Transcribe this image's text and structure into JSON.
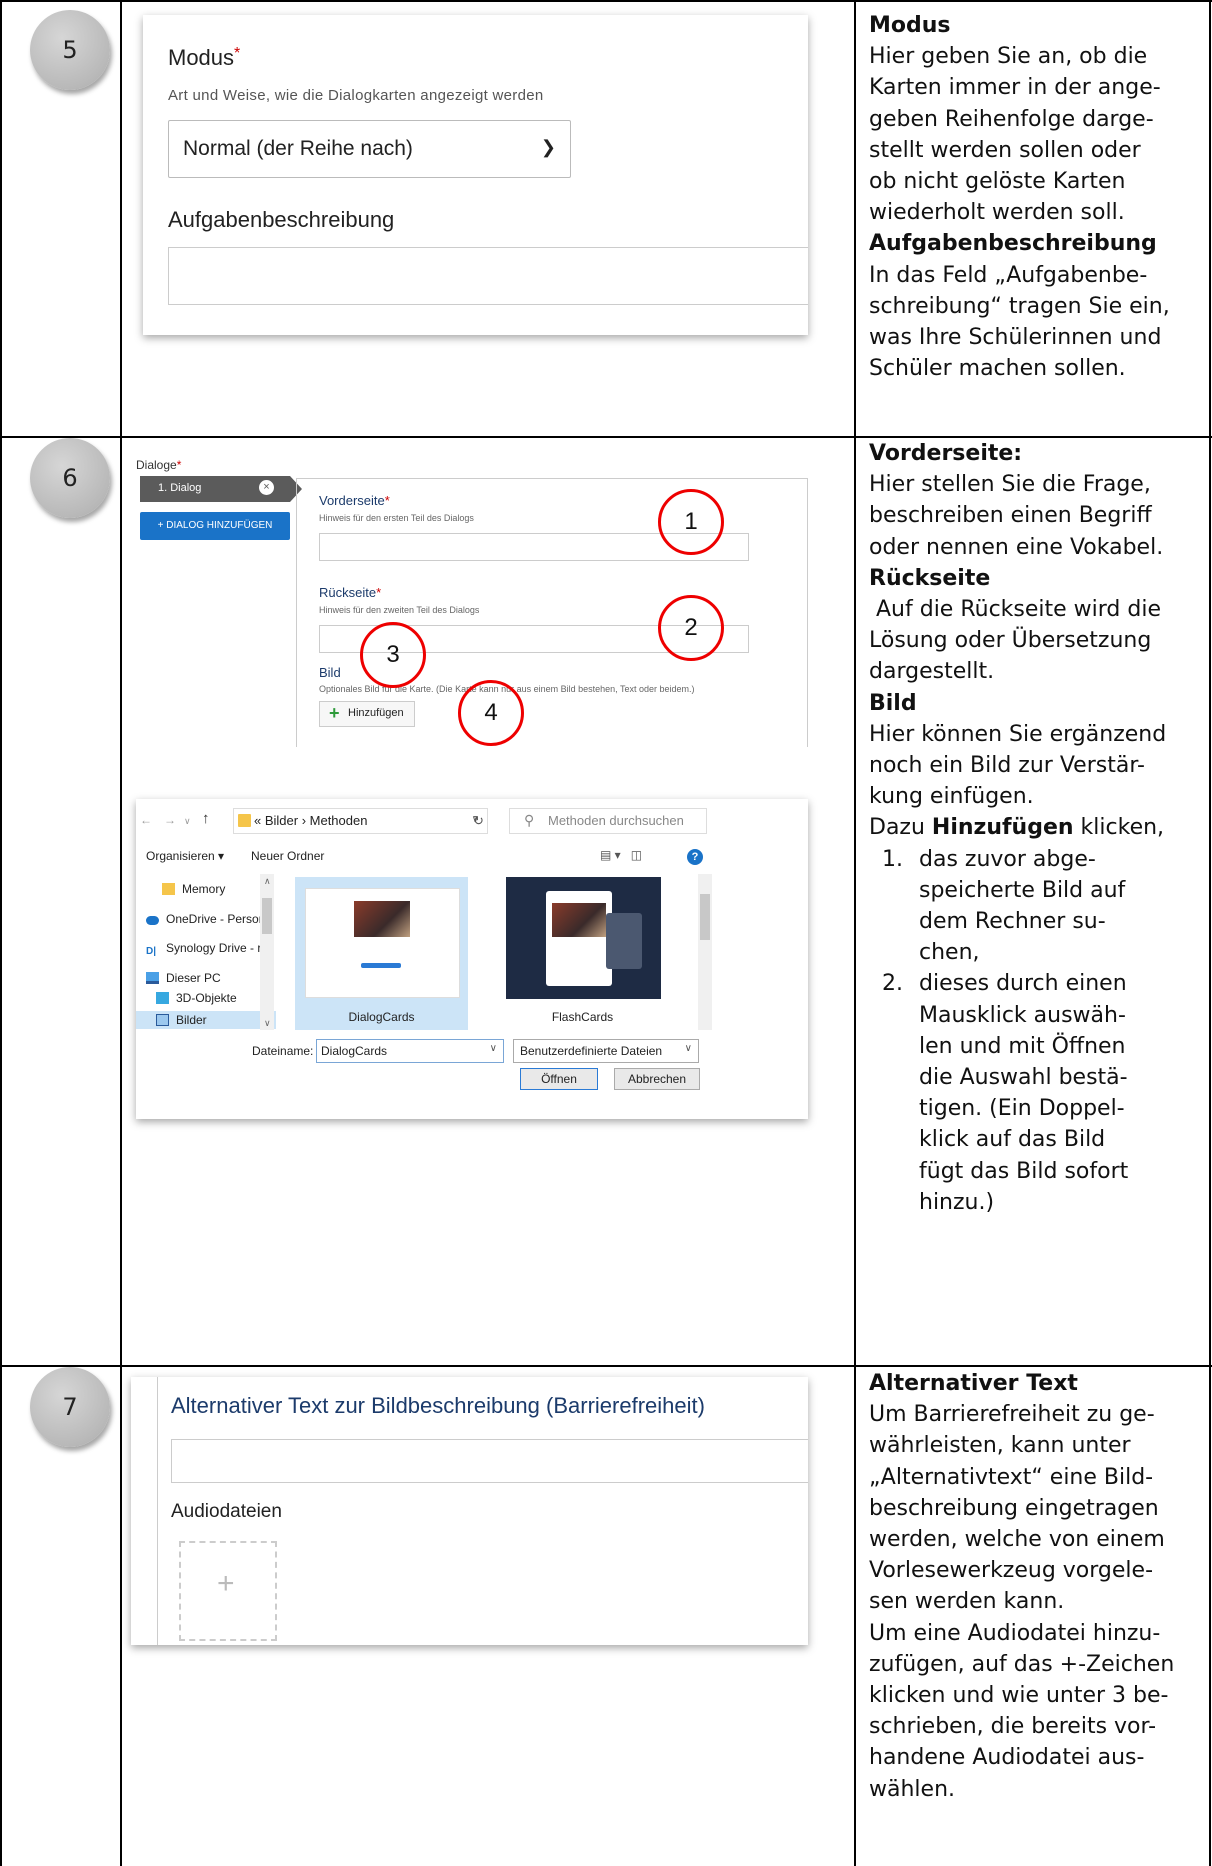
{
  "rows": [
    {
      "number": "5",
      "screenshot": {
        "mode_label": "Modus",
        "required_mark": "*",
        "mode_hint": "Art und Weise, wie die Dialogkarten angezeigt werden",
        "mode_selected": "Normal (der Reihe nach)",
        "task_label": "Aufgabenbeschreibung",
        "task_value": ""
      },
      "description": {
        "h1": "Modus",
        "lines1": [
          "Hier geben Sie an, ob die",
          "Karten immer in der ange-",
          "geben Reihenfolge darge-",
          "stellt werden sollen oder",
          "ob nicht gelöste Karten",
          "wiederholt werden soll."
        ],
        "h2": "Aufgabenbeschreibung",
        "lines2": [
          "In das Feld „Aufgabenbe-",
          "schreibung“ tragen Sie ein,",
          "was Ihre Schülerinnen und",
          "Schüler machen sollen."
        ]
      }
    },
    {
      "number": "6",
      "screenshot_editor": {
        "dialogs_label": "Dialoge",
        "required_mark": "*",
        "tab_label": "1. Dialog",
        "add_dialog_button": "+ DIALOG HINZUFÜGEN",
        "front_label": "Vorderseite",
        "front_hint": "Hinweis für den ersten Teil des Dialogs",
        "back_label": "Rückseite",
        "back_hint": "Hinweis für den zweiten Teil des Dialogs",
        "image_label": "Bild",
        "image_hint": "Optionales Bild für die Karte. (Die Karte kann nur aus einem Bild bestehen, Text oder beidem.)",
        "add_button": "Hinzufügen",
        "callouts": [
          "1",
          "2",
          "3",
          "4"
        ]
      },
      "screenshot_file_dialog": {
        "nav_back": "←",
        "nav_forward": "→",
        "nav_down": "∨",
        "nav_up": "↑",
        "path": "« Bilder › Methoden",
        "search_placeholder": "Methoden durchsuchen",
        "organize": "Organisieren ▾",
        "new_folder": "Neuer Ordner",
        "help": "?",
        "tree_items": [
          "Memory",
          "OneDrive - Persor",
          "Synology Drive - r",
          "Dieser PC",
          "3D-Objekte",
          "Bilder"
        ],
        "files": [
          "DialogCards",
          "FlashCards"
        ],
        "filename_label": "Dateiname:",
        "filename_value": "DialogCards",
        "filetype_value": "Benutzerdefinierte Dateien",
        "open_button": "Öffnen",
        "cancel_button": "Abbrechen"
      },
      "description": {
        "h1": "Vorderseite:",
        "lines1": [
          "Hier stellen Sie die Frage,",
          "beschreiben einen Begriff",
          "oder nennen eine Vokabel."
        ],
        "h2": "Rückseite",
        "lines2": [
          " Auf die Rückseite wird die",
          "Lösung oder Übersetzung",
          "dargestellt."
        ],
        "h3": "Bild",
        "lines3": [
          "Hier können Sie ergänzend",
          "noch ein Bild zur Verstär-",
          "kung einfügen."
        ],
        "click_pre": "Dazu ",
        "click_bold": "Hinzufügen",
        "click_post": " klicken,",
        "list": [
          {
            "n": "1.",
            "lines": [
              "das zuvor abge-",
              "speicherte Bild auf",
              "dem Rechner su-",
              "chen,"
            ]
          },
          {
            "n": "2.",
            "lines": [
              "dieses durch einen",
              "Mausklick auswäh-",
              "len und mit Öffnen",
              "die Auswahl bestä-",
              "tigen. (Ein Doppel-",
              "klick auf das Bild",
              "fügt das Bild sofort",
              "hinzu.)"
            ]
          }
        ]
      }
    },
    {
      "number": "7",
      "screenshot": {
        "alt_label": "Alternativer Text zur Bildbeschreibung (Barrierefreiheit)",
        "audio_label": "Audiodateien",
        "add_symbol": "+"
      },
      "description": {
        "h1": "Alternativer Text",
        "lines1": [
          "Um Barrierefreiheit zu ge-",
          "währleisten, kann unter",
          "„Alternativtext“ eine Bild-",
          "beschreibung eingetragen",
          "werden, welche von einem",
          "Vorlesewerkzeug vorgele-",
          "sen werden kann.",
          "Um eine Audiodatei hinzu-",
          "zufügen, auf das +-Zeichen",
          "klicken und wie unter 3 be-",
          "schrieben, die bereits vor-",
          "handene Audiodatei aus-",
          "wählen."
        ]
      }
    }
  ]
}
